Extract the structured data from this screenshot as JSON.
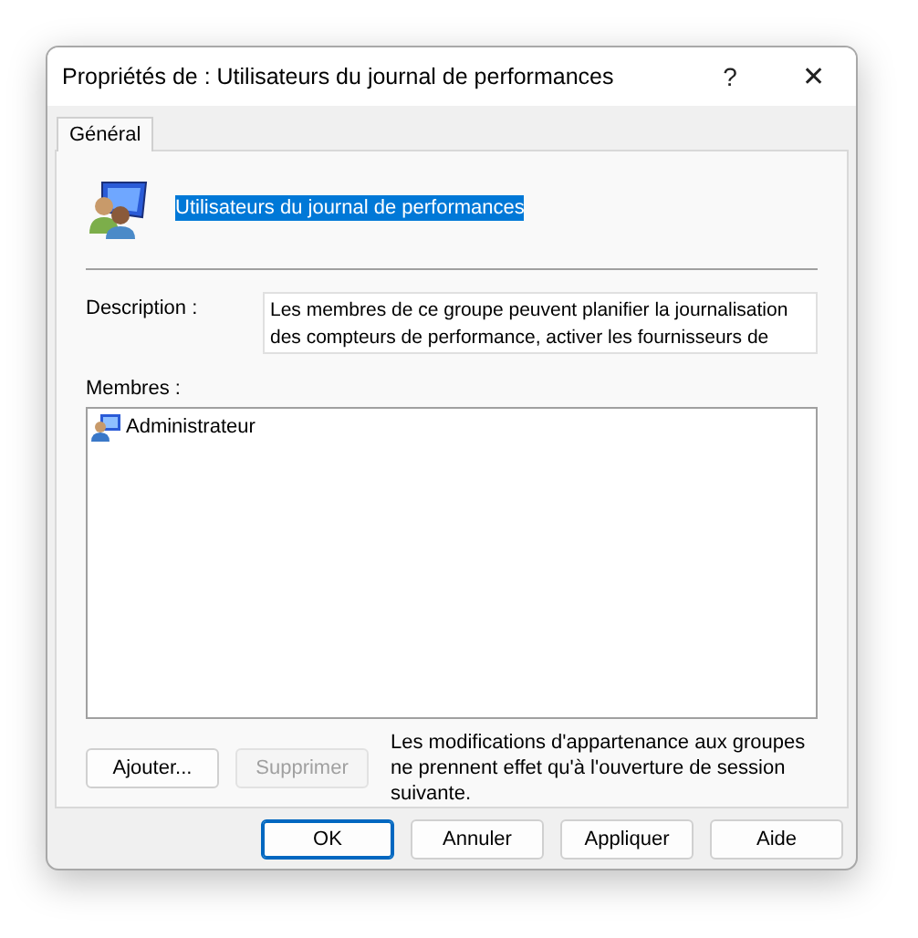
{
  "window": {
    "title": "Propriétés de : Utilisateurs du journal de performances",
    "help": "?",
    "close": "✕"
  },
  "tabs": [
    {
      "label": "Général",
      "selected": true
    }
  ],
  "group_name": {
    "value": "Utilisateurs du journal de performances",
    "selected": true
  },
  "description": {
    "label": "Description :",
    "value": "Les membres de ce groupe peuvent planifier la journalisation des compteurs de performance, activer les fournisseurs de"
  },
  "members": {
    "label": "Membres :",
    "items": [
      {
        "name": "Administrateur",
        "selected": false
      }
    ]
  },
  "member_buttons": [
    {
      "label": "Ajouter...",
      "disabled": false
    },
    {
      "label": "Supprimer",
      "disabled": true
    }
  ],
  "note": "Les modifications d'appartenance aux groupes ne prennent effet qu'à l'ouverture de session suivante.",
  "buttons": [
    {
      "label": "OK",
      "default": true
    },
    {
      "label": "Annuler",
      "default": false
    },
    {
      "label": "Appliquer",
      "default": false
    },
    {
      "label": "Aide",
      "default": false
    }
  ]
}
